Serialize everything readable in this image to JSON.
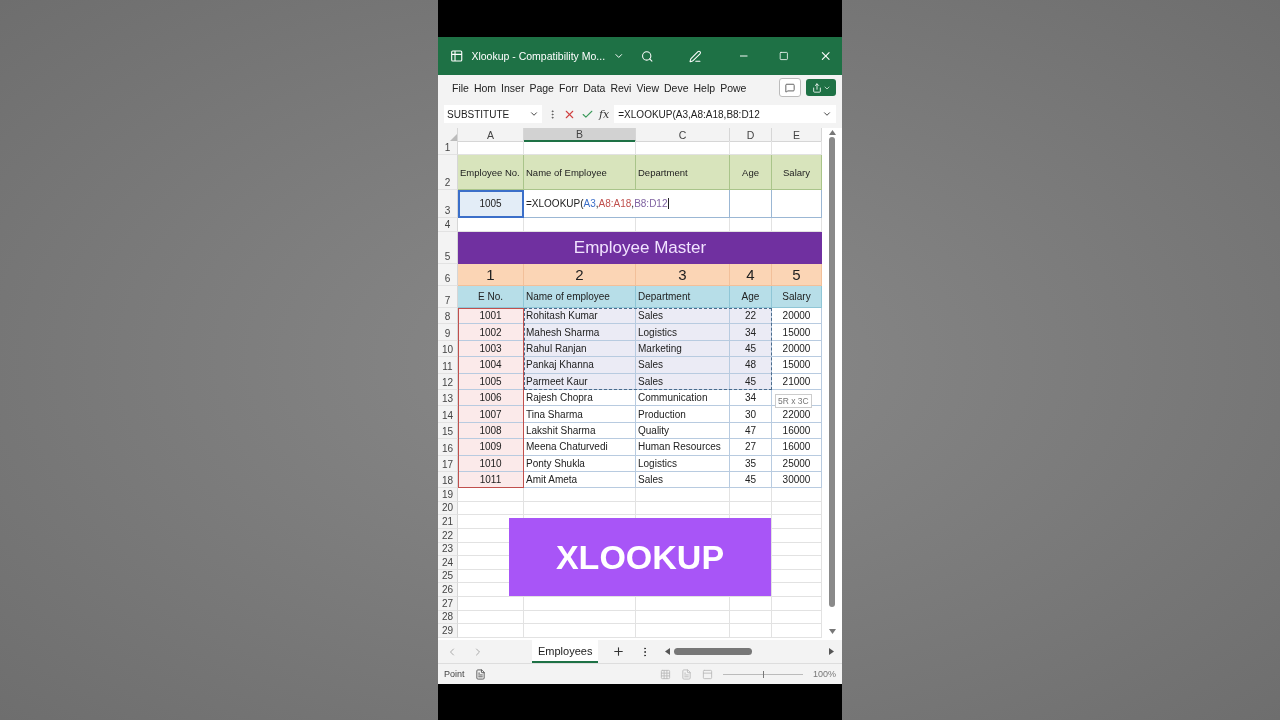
{
  "window": {
    "title": "Xlookup  -  Compatibility Mo..."
  },
  "menu": [
    {
      "label": "File"
    },
    {
      "label": "Hom"
    },
    {
      "label": "Inser"
    },
    {
      "label": "Page"
    },
    {
      "label": "Forr"
    },
    {
      "label": "Data"
    },
    {
      "label": "Revi"
    },
    {
      "label": "View"
    },
    {
      "label": "Deve"
    },
    {
      "label": "Help"
    },
    {
      "label": "Powe"
    }
  ],
  "formula_bar": {
    "name_box": "SUBSTITUTE",
    "function_label": "fx",
    "formula": "=XLOOKUP(A3,A8:A18,B8:D12"
  },
  "columns": [
    {
      "label": "A",
      "selected": false
    },
    {
      "label": "B",
      "selected": true
    },
    {
      "label": "C",
      "selected": false
    },
    {
      "label": "D",
      "selected": false
    },
    {
      "label": "E",
      "selected": false
    }
  ],
  "rows": [
    {
      "number": "1",
      "kind": "blank"
    },
    {
      "number": "2",
      "kind": "lookup-header",
      "cells": [
        "Employee No.",
        "Name of Employee",
        "Department",
        "Age",
        "Salary"
      ]
    },
    {
      "number": "3",
      "kind": "lookup-input",
      "cells": [
        "1005"
      ],
      "formula_parts": [
        {
          "text": "=XLOOKUP("
        },
        {
          "text": "A3",
          "color": "#3b6fc9"
        },
        {
          "text": ","
        },
        {
          "text": "A8:A18",
          "color": "#c0504d"
        },
        {
          "text": ","
        },
        {
          "text": "B8:D12",
          "color": "#8064a2"
        }
      ]
    },
    {
      "number": "4",
      "kind": "blank"
    },
    {
      "number": "5",
      "kind": "title",
      "cells": [
        "Employee Master"
      ]
    },
    {
      "number": "6",
      "kind": "index",
      "cells": [
        "1",
        "2",
        "3",
        "4",
        "5"
      ]
    },
    {
      "number": "7",
      "kind": "table-header",
      "cells": [
        "E No.",
        "Name of employee",
        "Department",
        "Age",
        "Salary"
      ]
    },
    {
      "number": "8",
      "kind": "data",
      "in_range": true,
      "cells": [
        "1001",
        "Rohitash Kumar",
        "Sales",
        "22",
        "20000"
      ]
    },
    {
      "number": "9",
      "kind": "data",
      "in_range": true,
      "cells": [
        "1002",
        "Mahesh Sharma",
        "Logistics",
        "34",
        "15000"
      ]
    },
    {
      "number": "10",
      "kind": "data",
      "in_range": true,
      "cells": [
        "1003",
        "Rahul Ranjan",
        "Marketing",
        "45",
        "20000"
      ]
    },
    {
      "number": "11",
      "kind": "data",
      "in_range": true,
      "cells": [
        "1004",
        "Pankaj Khanna",
        "Sales",
        "48",
        "15000"
      ]
    },
    {
      "number": "12",
      "kind": "data",
      "in_range": true,
      "cells": [
        "1005",
        "Parmeet Kaur",
        "Sales",
        "45",
        "21000"
      ]
    },
    {
      "number": "13",
      "kind": "data",
      "in_range": false,
      "cells": [
        "1006",
        "Rajesh Chopra",
        "Communication",
        "34"
      ]
    },
    {
      "number": "14",
      "kind": "data",
      "in_range": false,
      "cells": [
        "1007",
        "Tina Sharma",
        "Production",
        "30",
        "22000"
      ]
    },
    {
      "number": "15",
      "kind": "data",
      "in_range": false,
      "cells": [
        "1008",
        "Lakshit Sharma",
        "Quality",
        "47",
        "16000"
      ]
    },
    {
      "number": "16",
      "kind": "data",
      "in_range": false,
      "cells": [
        "1009",
        "Meena Chaturvedi",
        "Human Resources",
        "27",
        "16000"
      ]
    },
    {
      "number": "17",
      "kind": "data",
      "in_range": false,
      "cells": [
        "1010",
        "Ponty Shukla",
        "Logistics",
        "35",
        "25000"
      ]
    },
    {
      "number": "18",
      "kind": "data",
      "in_range": false,
      "cells": [
        "1011",
        "Amit Ameta",
        "Sales",
        "45",
        "30000"
      ]
    },
    {
      "number": "19",
      "kind": "tail"
    },
    {
      "number": "20",
      "kind": "tail"
    },
    {
      "number": "21",
      "kind": "tail"
    },
    {
      "number": "22",
      "kind": "tail"
    },
    {
      "number": "23",
      "kind": "tail"
    },
    {
      "number": "24",
      "kind": "tail"
    },
    {
      "number": "25",
      "kind": "tail"
    },
    {
      "number": "26",
      "kind": "tail"
    },
    {
      "number": "27",
      "kind": "tail"
    },
    {
      "number": "28",
      "kind": "tail"
    },
    {
      "number": "29",
      "kind": "tail"
    }
  ],
  "range_tooltip": "5R x 3C",
  "banner": "XLOOKUP",
  "sheet_tabs": [
    {
      "label": "Employees",
      "selected": true
    }
  ],
  "status_bar": {
    "mode": "Point",
    "zoom": {
      "level": 0.5,
      "reading": "100%"
    }
  }
}
